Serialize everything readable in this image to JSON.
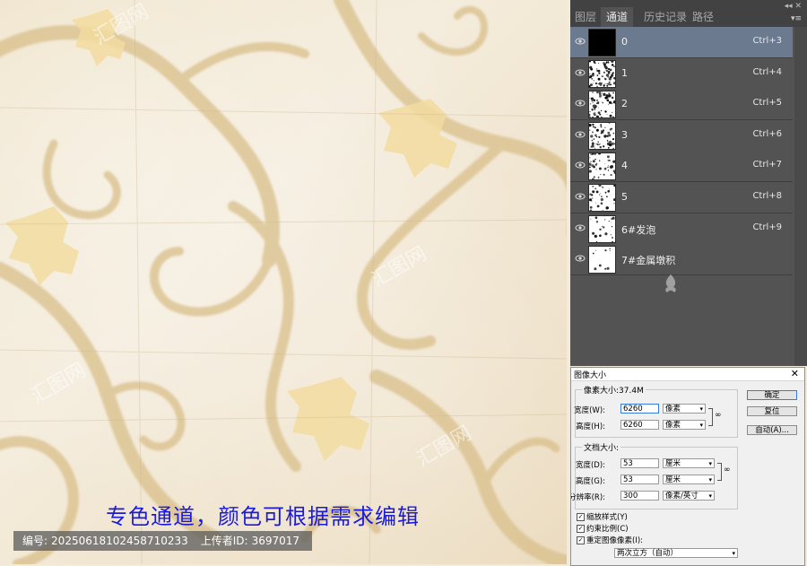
{
  "caption": "专色通道，颜色可根据需求编辑",
  "id_bar": {
    "number_label": "编号:",
    "number": "20250618102458710233",
    "uploader_label": "上传者ID:",
    "uploader": "3697017"
  },
  "channels_panel": {
    "tabs": [
      "图层",
      "通道",
      "历史记录",
      "路径"
    ],
    "active_tab": "通道",
    "channels": [
      {
        "name": "0",
        "shortcut": "Ctrl+3",
        "selected": true
      },
      {
        "name": "1",
        "shortcut": "Ctrl+4",
        "selected": false
      },
      {
        "name": "2",
        "shortcut": "Ctrl+5",
        "selected": false
      },
      {
        "name": "3",
        "shortcut": "Ctrl+6",
        "selected": false
      },
      {
        "name": "4",
        "shortcut": "Ctrl+7",
        "selected": false
      },
      {
        "name": "5",
        "shortcut": "Ctrl+8",
        "selected": false
      },
      {
        "name": "6#发泡",
        "shortcut": "Ctrl+9",
        "selected": false
      },
      {
        "name": "7#金属墩积",
        "shortcut": "",
        "selected": false
      }
    ]
  },
  "image_size_dialog": {
    "title": "图像大小",
    "pixel_dimensions_label": "像素大小:37.4M",
    "pixel_width_label": "宽度(W):",
    "pixel_width": "6260",
    "pixel_width_unit": "像素",
    "pixel_height_label": "高度(H):",
    "pixel_height": "6260",
    "pixel_height_unit": "像素",
    "doc_size_label": "文档大小:",
    "doc_width_label": "宽度(D):",
    "doc_width": "53",
    "doc_width_unit": "厘米",
    "doc_height_label": "高度(G):",
    "doc_height": "53",
    "doc_height_unit": "厘米",
    "resolution_label": "分辨率(R):",
    "resolution": "300",
    "resolution_unit": "像素/英寸",
    "ok_button": "确定",
    "reset_button": "复位",
    "auto_button": "自动(A)...",
    "scale_styles": "缩放样式(Y)",
    "constrain_proportions": "约束比例(C)",
    "resample": "重定图像像素(I):",
    "resample_method": "两次立方（自动）"
  },
  "colors": {
    "caption": "#1a1adb",
    "panel_bg": "#535353",
    "selected_row": "#6c7a90",
    "texture_base": "#efe3c9",
    "swirl": "#d9bf8a",
    "damask": "#f2dca0"
  },
  "icons": {
    "eye": "eye-icon",
    "link": "chain-link-icon",
    "watermark": "huitu-watermark-icon"
  }
}
